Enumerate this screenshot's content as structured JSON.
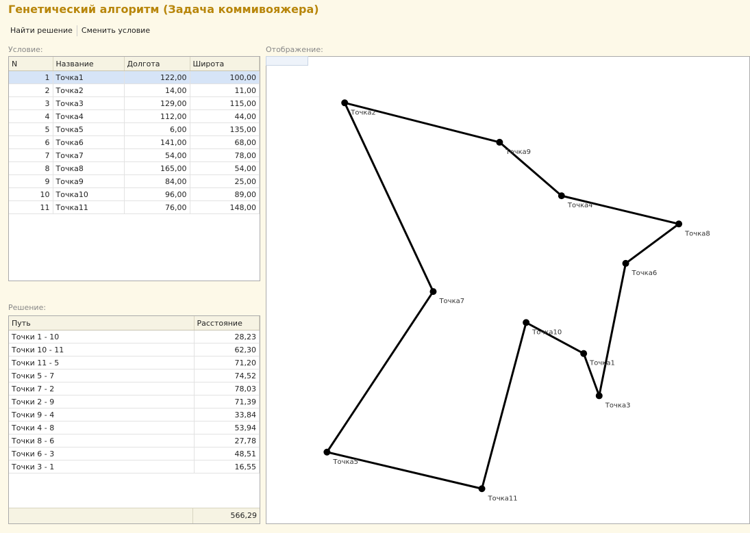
{
  "window": {
    "title": "Генетический алгоритм (Задача коммивояжера)"
  },
  "toolbar": {
    "find": "Найти решение",
    "change": "Сменить условие"
  },
  "condition": {
    "label": "Условие:",
    "headers": [
      "N",
      "Название",
      "Долгота",
      "Широта"
    ],
    "rows": [
      [
        "1",
        "Точка1",
        "122,00",
        "100,00"
      ],
      [
        "2",
        "Точка2",
        "14,00",
        "11,00"
      ],
      [
        "3",
        "Точка3",
        "129,00",
        "115,00"
      ],
      [
        "4",
        "Точка4",
        "112,00",
        "44,00"
      ],
      [
        "5",
        "Точка5",
        "6,00",
        "135,00"
      ],
      [
        "6",
        "Точка6",
        "141,00",
        "68,00"
      ],
      [
        "7",
        "Точка7",
        "54,00",
        "78,00"
      ],
      [
        "8",
        "Точка8",
        "165,00",
        "54,00"
      ],
      [
        "9",
        "Точка9",
        "84,00",
        "25,00"
      ],
      [
        "10",
        "Точка10",
        "96,00",
        "89,00"
      ],
      [
        "11",
        "Точка11",
        "76,00",
        "148,00"
      ]
    ]
  },
  "solution": {
    "label": "Решение:",
    "headers": [
      "Путь",
      "Расстояние"
    ],
    "rows": [
      [
        "Точки 1 - 10",
        "28,23"
      ],
      [
        "Точки 10 - 11",
        "62,30"
      ],
      [
        "Точки 11 - 5",
        "71,20"
      ],
      [
        "Точки 5 - 7",
        "74,52"
      ],
      [
        "Точки 7 - 2",
        "78,03"
      ],
      [
        "Точки 2 - 9",
        "71,39"
      ],
      [
        "Точки 9 - 4",
        "33,84"
      ],
      [
        "Точки 4 - 8",
        "53,94"
      ],
      [
        "Точки 8 - 6",
        "27,78"
      ],
      [
        "Точки 6 - 3",
        "48,51"
      ],
      [
        "Точки 3 - 1",
        "16,55"
      ]
    ],
    "total": "566,29"
  },
  "display": {
    "label": "Отображение:",
    "points": [
      {
        "name": "Точка1",
        "lon": 122,
        "lat": 100
      },
      {
        "name": "Точка2",
        "lon": 14,
        "lat": 11
      },
      {
        "name": "Точка3",
        "lon": 129,
        "lat": 115
      },
      {
        "name": "Точка4",
        "lon": 112,
        "lat": 44
      },
      {
        "name": "Точка5",
        "lon": 6,
        "lat": 135
      },
      {
        "name": "Точка6",
        "lon": 141,
        "lat": 68
      },
      {
        "name": "Точка7",
        "lon": 54,
        "lat": 78
      },
      {
        "name": "Точка8",
        "lon": 165,
        "lat": 54
      },
      {
        "name": "Точка9",
        "lon": 84,
        "lat": 25
      },
      {
        "name": "Точка10",
        "lon": 96,
        "lat": 89
      },
      {
        "name": "Точка11",
        "lon": 76,
        "lat": 148
      }
    ],
    "route": [
      1,
      10,
      11,
      5,
      7,
      2,
      9,
      4,
      8,
      6,
      3,
      1
    ]
  }
}
